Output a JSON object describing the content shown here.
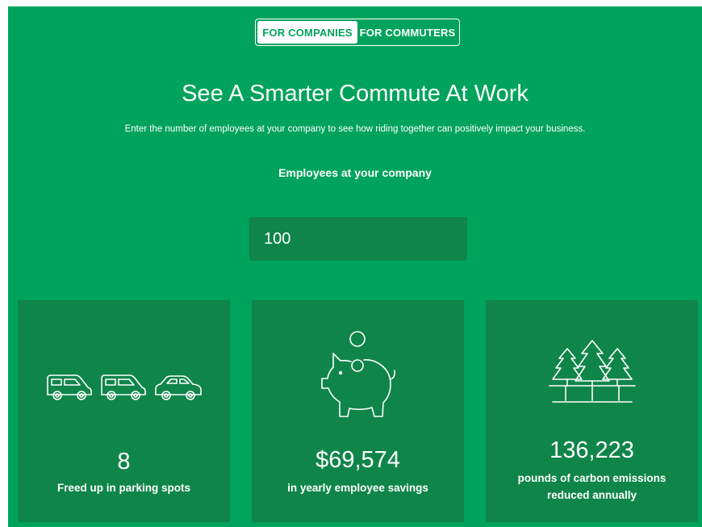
{
  "tabs": {
    "companies": "FOR COMPANIES",
    "commuters": "FOR COMMUTERS"
  },
  "hero": {
    "title": "See A Smarter Commute At Work",
    "subtitle": "Enter the number of employees at your company to see how riding together can positively impact your business."
  },
  "form": {
    "label": "Employees at your company",
    "value": "100"
  },
  "stats": {
    "parking": {
      "value": "8",
      "label": "Freed up in parking spots",
      "icon": "vehicles-icon"
    },
    "savings": {
      "value": "$69,574",
      "label": "in yearly employee savings",
      "icon": "piggy-bank-icon"
    },
    "carbon": {
      "value": "136,223",
      "label_line1": "pounds of carbon emissions",
      "label_line2": "reduced annually",
      "icon": "trees-icon"
    }
  },
  "colors": {
    "background": "#00a35c",
    "card": "#0f854a",
    "text": "#ffffff"
  }
}
